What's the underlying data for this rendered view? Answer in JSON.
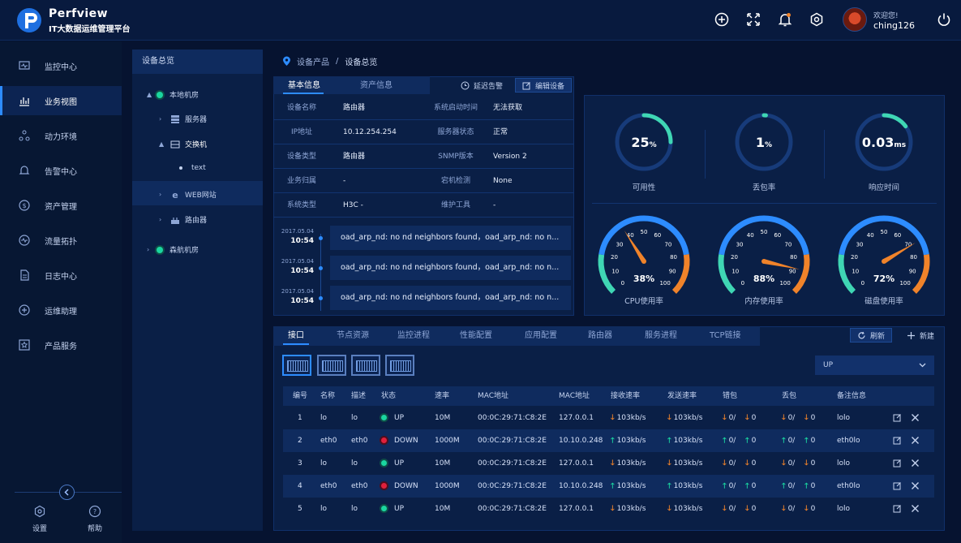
{
  "header": {
    "brand": "Perfview",
    "subtitle": "IT大数据运维管理平台",
    "welcome": "欢迎您!",
    "username": "ching126"
  },
  "sidebar": {
    "items": [
      {
        "label": "监控中心",
        "icon": "monitor-icon"
      },
      {
        "label": "业务视图",
        "icon": "bar-chart-icon",
        "active": true
      },
      {
        "label": "动力环境",
        "icon": "nodes-icon"
      },
      {
        "label": "告警中心",
        "icon": "bell-icon"
      },
      {
        "label": "资产管理",
        "icon": "dollar-icon"
      },
      {
        "label": "流量拓扑",
        "icon": "wave-icon"
      },
      {
        "label": "日志中心",
        "icon": "document-icon"
      },
      {
        "label": "运维助理",
        "icon": "plus-shield-icon"
      },
      {
        "label": "产品服务",
        "icon": "star-icon"
      }
    ],
    "settings_label": "设置",
    "help_label": "帮助"
  },
  "tree": {
    "title": "设备总览",
    "nodes": {
      "room1": "本地机房",
      "server": "服务器",
      "switch": "交换机",
      "text": "text",
      "web": "WEB网站",
      "router": "路由器",
      "room2": "森航机房"
    }
  },
  "breadcrumb": {
    "part1": "设备产品",
    "part2": "设备总览"
  },
  "info": {
    "tabs": [
      "基本信息",
      "资产信息"
    ],
    "delay_alarm": "延迟告警",
    "edit_device": "编辑设备",
    "rows": [
      {
        "k1": "设备名称",
        "v1": "路由器",
        "k2": "系统启动时间",
        "v2": "无法获取"
      },
      {
        "k1": "IP地址",
        "v1": "10.12.254.254",
        "k2": "服务器状态",
        "v2": "正常"
      },
      {
        "k1": "设备类型",
        "v1": "路由器",
        "k2": "SNMP版本",
        "v2": "Version 2"
      },
      {
        "k1": "业务归属",
        "v1": "-",
        "k2": "宕机检测",
        "v2": "None"
      },
      {
        "k1": "系统类型",
        "v1": "H3C -",
        "k2": "维护工具",
        "v2": "-"
      }
    ]
  },
  "logs": [
    {
      "date": "2017.05.04",
      "time": "10:54",
      "message": "oad_arp_nd: no nd neighbors found，oad_arp_nd: no n..."
    },
    {
      "date": "2017.05.04",
      "time": "10:54",
      "message": "oad_arp_nd: no nd neighbors found，oad_arp_nd: no n..."
    },
    {
      "date": "2017.05.04",
      "time": "10:54",
      "message": "oad_arp_nd: no nd neighbors found，oad_arp_nd: no n..."
    }
  ],
  "metrics": {
    "rings": [
      {
        "value": "25",
        "unit": "%",
        "label": "可用性",
        "fraction": 0.25
      },
      {
        "value": "1",
        "unit": "%",
        "label": "丢包率",
        "fraction": 0.01
      },
      {
        "value": "0.03",
        "unit": "ms",
        "label": "响应时间",
        "fraction": 0.15
      }
    ],
    "gauges": [
      {
        "value": 38,
        "text": "38%",
        "label": "CPU使用率"
      },
      {
        "value": 88,
        "text": "88%",
        "label": "内存使用率"
      },
      {
        "value": 72,
        "text": "72%",
        "label": "磁盘使用率"
      }
    ],
    "gauge_ticks": [
      "0",
      "10",
      "20",
      "30",
      "40",
      "50",
      "60",
      "70",
      "80",
      "90",
      "100"
    ]
  },
  "ports": {
    "tabs": [
      "接口",
      "节点资源",
      "监控进程",
      "性能配置",
      "应用配置",
      "路由器",
      "服务进程",
      "TCP链接"
    ],
    "refresh": "刷新",
    "add": "新建",
    "filter_value": "UP",
    "columns": [
      "编号",
      "名称",
      "描述",
      "状态",
      "速率",
      "MAC地址",
      "MAC地址",
      "接收速率",
      "发送速率",
      "错包",
      "丢包",
      "备注信息"
    ],
    "rows": [
      {
        "id": "1",
        "name": "lo",
        "desc": "lo",
        "status": "UP",
        "speed": "10M",
        "mac": "00:0C:29:71:C8:2E",
        "ip": "127.0.0.1",
        "rx": "103kb/s",
        "rx_dir": "down",
        "tx": "103kb/s",
        "tx_dir": "down",
        "err_a": "0/",
        "err_b": "0",
        "err_dir": "down",
        "drop_a": "0/",
        "drop_b": "0",
        "drop_dir": "down",
        "note": "lolo"
      },
      {
        "id": "2",
        "name": "eth0",
        "desc": "eth0",
        "status": "DOWN",
        "speed": "1000M",
        "mac": "00:0C:29:71:C8:2E",
        "ip": "10.10.0.248",
        "rx": "103kb/s",
        "rx_dir": "up",
        "tx": "103kb/s",
        "tx_dir": "up",
        "err_a": "0/",
        "err_b": "0",
        "err_dir": "up",
        "drop_a": "0/",
        "drop_b": "0",
        "drop_dir": "up",
        "note": "eth0lo"
      },
      {
        "id": "3",
        "name": "lo",
        "desc": "lo",
        "status": "UP",
        "speed": "10M",
        "mac": "00:0C:29:71:C8:2E",
        "ip": "127.0.0.1",
        "rx": "103kb/s",
        "rx_dir": "down",
        "tx": "103kb/s",
        "tx_dir": "down",
        "err_a": "0/",
        "err_b": "0",
        "err_dir": "down",
        "drop_a": "0/",
        "drop_b": "0",
        "drop_dir": "down",
        "note": "lolo"
      },
      {
        "id": "4",
        "name": "eth0",
        "desc": "eth0",
        "status": "DOWN",
        "speed": "1000M",
        "mac": "00:0C:29:71:C8:2E",
        "ip": "10.10.0.248",
        "rx": "103kb/s",
        "rx_dir": "up",
        "tx": "103kb/s",
        "tx_dir": "up",
        "err_a": "0/",
        "err_b": "0",
        "err_dir": "up",
        "drop_a": "0/",
        "drop_b": "0",
        "drop_dir": "up",
        "note": "eth0lo"
      },
      {
        "id": "5",
        "name": "lo",
        "desc": "lo",
        "status": "UP",
        "speed": "10M",
        "mac": "00:0C:29:71:C8:2E",
        "ip": "127.0.0.1",
        "rx": "103kb/s",
        "rx_dir": "down",
        "tx": "103kb/s",
        "tx_dir": "down",
        "err_a": "0/",
        "err_b": "0",
        "err_dir": "down",
        "drop_a": "0/",
        "drop_b": "0",
        "drop_dir": "down",
        "note": "lolo"
      }
    ]
  },
  "colors": {
    "accent": "#2d8cff",
    "teal": "#3fd6b4",
    "orange": "#f0832a",
    "up": "#1ad6a0",
    "down": "#e0203c"
  }
}
